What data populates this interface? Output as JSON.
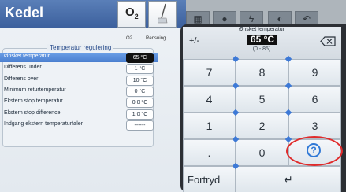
{
  "app": {
    "title": "Kedel"
  },
  "toolbar": {
    "o2_symbol": "O",
    "o2_subscript": "2",
    "o2_label": "O2",
    "rensning_label": "Rensning"
  },
  "section": {
    "title": "Temperatur regulering"
  },
  "settings": {
    "rows": [
      {
        "label": "Ønsket temperatur",
        "value": "65 °C",
        "selected": true
      },
      {
        "label": "Differens under",
        "value": "1 °C"
      },
      {
        "label": "Differens over",
        "value": "10 °C"
      },
      {
        "label": "Minimum returtemperatur",
        "value": "0 °C"
      },
      {
        "label": "Ekstern stop temperatur",
        "value": "0,0 °C"
      },
      {
        "label": "Ekstern stop difference",
        "value": "1,0 °C"
      },
      {
        "label": "Indgang ekstern temperaturføler",
        "value": "------"
      }
    ]
  },
  "keypad": {
    "caption": "Ønsket temperatur",
    "value": "65 °C",
    "range": "(0 - 85)",
    "plusminus": "+/-",
    "keys": {
      "k7": "7",
      "k8": "8",
      "k9": "9",
      "k4": "4",
      "k5": "5",
      "k6": "6",
      "k1": "1",
      "k2": "2",
      "k3": "3",
      "dot": ".",
      "k0": "0",
      "help": "?",
      "cancel": "Fortryd",
      "enter": "↵"
    }
  },
  "annotation": {
    "ring_color": "#e02a2a"
  },
  "colors": {
    "accent": "#2f78d6",
    "titlebar": "#3b5f9c",
    "selected_row": "#4a7fcf"
  }
}
